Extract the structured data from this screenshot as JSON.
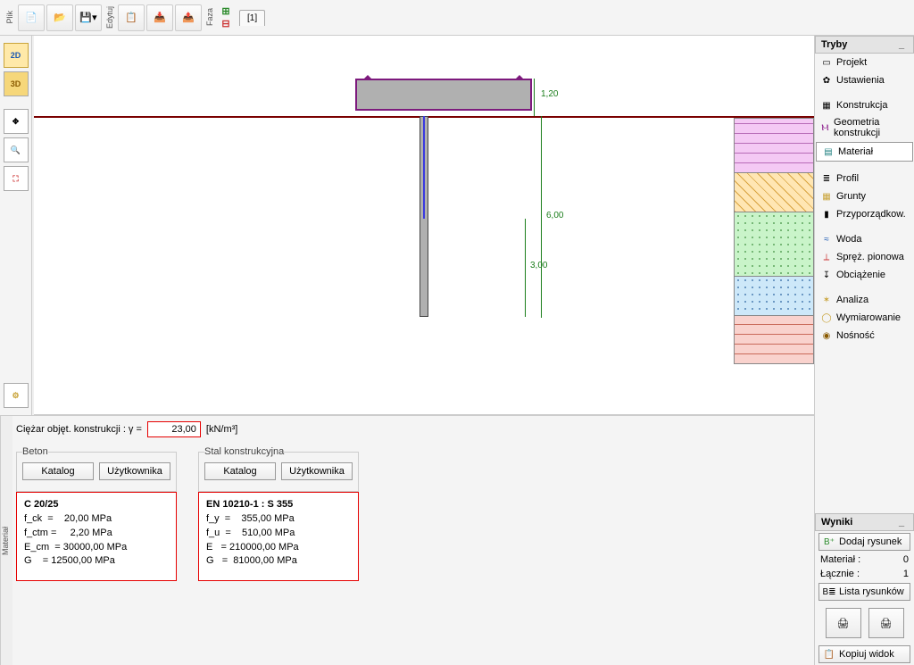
{
  "toolbar": {
    "file_label": "Plik",
    "edit_label": "Edytuj",
    "phase_label": "Faza",
    "phase_tab": "[1]"
  },
  "left_tools": {
    "view2d": "2D",
    "view3d": "3D"
  },
  "dimensions": {
    "d1": "1,20",
    "d2": "6,00",
    "d3": "3,00"
  },
  "modes": {
    "header": "Tryby",
    "project": "Projekt",
    "settings": "Ustawienia",
    "construction": "Konstrukcja",
    "geometry": "Geometria konstrukcji",
    "material": "Materiał",
    "profile": "Profil",
    "soils": "Grunty",
    "assign": "Przyporządkow.",
    "water": "Woda",
    "spring": "Spręż. pionowa",
    "load": "Obciążenie",
    "analysis": "Analiza",
    "dimensioning": "Wymiarowanie",
    "capacity": "Nośność"
  },
  "results": {
    "header": "Wyniki",
    "add_drawing": "Dodaj rysunek",
    "material_label": "Materiał :",
    "material_count": "0",
    "total_label": "Łącznie :",
    "total_count": "1",
    "drawing_list": "Lista rysunków",
    "copy_view": "Kopiuj widok"
  },
  "bottom": {
    "tab_label": "Materiał",
    "weight_label": "Ciężar objęt. konstrukcji :   γ =",
    "weight_value": "23,00",
    "weight_unit": "[kN/m³]",
    "concrete_legend": "Beton",
    "steel_legend": "Stal konstrukcyjna",
    "catalog_btn": "Katalog",
    "user_btn": "Użytkownika",
    "concrete": {
      "title": "C 20/25",
      "rows": "f_ck  =    20,00 MPa\nf_ctm =     2,20 MPa\nE_cm  = 30000,00 MPa\nG    = 12500,00 MPa"
    },
    "steel": {
      "title": "EN 10210-1 : S 355",
      "rows": "f_y  =    355,00 MPa\nf_u  =    510,00 MPa\nE   = 210000,00 MPa\nG   =  81000,00 MPa"
    }
  }
}
